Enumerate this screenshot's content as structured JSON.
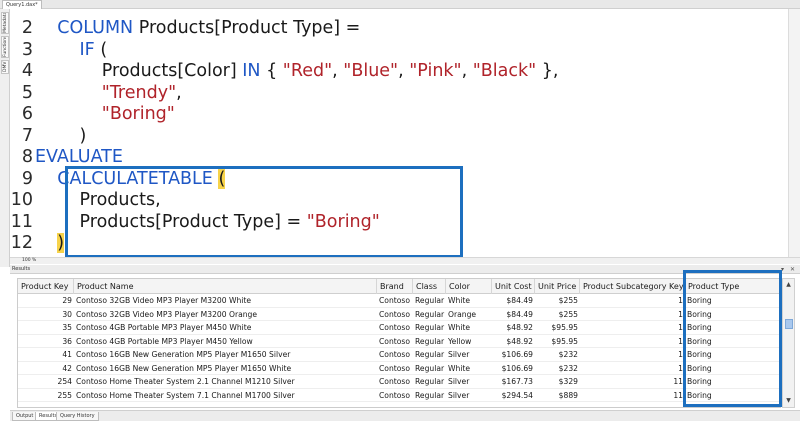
{
  "document_tab": {
    "label": "Query1.dax*"
  },
  "side_tabs": [
    "Metadata",
    "Functions",
    "DMV"
  ],
  "editor": {
    "lines": [
      {
        "num": "2",
        "indent": "    ",
        "tokens": [
          {
            "t": "COLUMN",
            "c": "kw"
          },
          {
            "t": " Products[Product Type] =",
            "c": "tx"
          }
        ]
      },
      {
        "num": "3",
        "indent": "        ",
        "tokens": [
          {
            "t": "IF",
            "c": "fn"
          },
          {
            "t": " (",
            "c": "tx"
          }
        ]
      },
      {
        "num": "4",
        "indent": "            ",
        "tokens": [
          {
            "t": "Products[Color] ",
            "c": "tx"
          },
          {
            "t": "IN",
            "c": "kw"
          },
          {
            "t": " { ",
            "c": "tx"
          },
          {
            "t": "\"Red\"",
            "c": "st"
          },
          {
            "t": ", ",
            "c": "tx"
          },
          {
            "t": "\"Blue\"",
            "c": "st"
          },
          {
            "t": ", ",
            "c": "tx"
          },
          {
            "t": "\"Pink\"",
            "c": "st"
          },
          {
            "t": ", ",
            "c": "tx"
          },
          {
            "t": "\"Black\"",
            "c": "st"
          },
          {
            "t": " },",
            "c": "tx"
          }
        ]
      },
      {
        "num": "5",
        "indent": "            ",
        "tokens": [
          {
            "t": "\"Trendy\"",
            "c": "st"
          },
          {
            "t": ",",
            "c": "tx"
          }
        ]
      },
      {
        "num": "6",
        "indent": "            ",
        "tokens": [
          {
            "t": "\"Boring\"",
            "c": "st"
          }
        ]
      },
      {
        "num": "7",
        "indent": "        ",
        "tokens": [
          {
            "t": ")",
            "c": "tx"
          }
        ]
      },
      {
        "num": "8",
        "indent": "",
        "tokens": [
          {
            "t": "EVALUATE",
            "c": "kw"
          }
        ]
      },
      {
        "num": "9",
        "indent": "    ",
        "tokens": [
          {
            "t": "CALCULATETABLE",
            "c": "fn"
          },
          {
            "t": " ",
            "c": "tx"
          },
          {
            "t": "(",
            "c": "hl"
          }
        ]
      },
      {
        "num": "10",
        "indent": "        ",
        "tokens": [
          {
            "t": "Products,",
            "c": "tx"
          }
        ]
      },
      {
        "num": "11",
        "indent": "        ",
        "tokens": [
          {
            "t": "Products[Product Type] = ",
            "c": "tx"
          },
          {
            "t": "\"Boring\"",
            "c": "st"
          }
        ]
      },
      {
        "num": "12",
        "indent": "    ",
        "tokens": [
          {
            "t": ")",
            "c": "hl"
          }
        ]
      }
    ]
  },
  "status": {
    "zoom": "100 %"
  },
  "results": {
    "title": "Results",
    "window_buttons": "▾ ✕",
    "columns": [
      "Product Key",
      "Product Name",
      "Brand",
      "Class",
      "Color",
      "Unit Cost",
      "Unit Price",
      "Product Subcategory Key",
      "Product Type"
    ],
    "rows": [
      [
        "29",
        "Contoso 32GB Video MP3 Player M3200 White",
        "Contoso",
        "Regular",
        "White",
        "$84.49",
        "$255",
        "1",
        "Boring"
      ],
      [
        "30",
        "Contoso 32GB Video MP3 Player M3200 Orange",
        "Contoso",
        "Regular",
        "Orange",
        "$84.49",
        "$255",
        "1",
        "Boring"
      ],
      [
        "35",
        "Contoso 4GB Portable MP3 Player M450 White",
        "Contoso",
        "Regular",
        "White",
        "$48.92",
        "$95.95",
        "1",
        "Boring"
      ],
      [
        "36",
        "Contoso 4GB Portable MP3 Player M450 Yellow",
        "Contoso",
        "Regular",
        "Yellow",
        "$48.92",
        "$95.95",
        "1",
        "Boring"
      ],
      [
        "41",
        "Contoso 16GB New Generation MP5 Player M1650 Silver",
        "Contoso",
        "Regular",
        "Silver",
        "$106.69",
        "$232",
        "1",
        "Boring"
      ],
      [
        "42",
        "Contoso 16GB New Generation MP5 Player M1650 White",
        "Contoso",
        "Regular",
        "White",
        "$106.69",
        "$232",
        "1",
        "Boring"
      ],
      [
        "254",
        "Contoso Home Theater System 2.1 Channel M1210 Silver",
        "Contoso",
        "Regular",
        "Silver",
        "$167.73",
        "$329",
        "11",
        "Boring"
      ],
      [
        "255",
        "Contoso Home Theater System 7.1 Channel M1700 Silver",
        "Contoso",
        "Regular",
        "Silver",
        "$294.54",
        "$889",
        "11",
        "Boring"
      ]
    ]
  },
  "bottom_tabs": [
    {
      "label": "Output",
      "active": false
    },
    {
      "label": "Results",
      "active": true
    },
    {
      "label": "Query History",
      "active": false
    }
  ],
  "colors": {
    "accent_box": "#1d6fbf",
    "keyword": "#1f57c5",
    "string": "#b0232a",
    "brace_highlight": "#f7d34a"
  }
}
